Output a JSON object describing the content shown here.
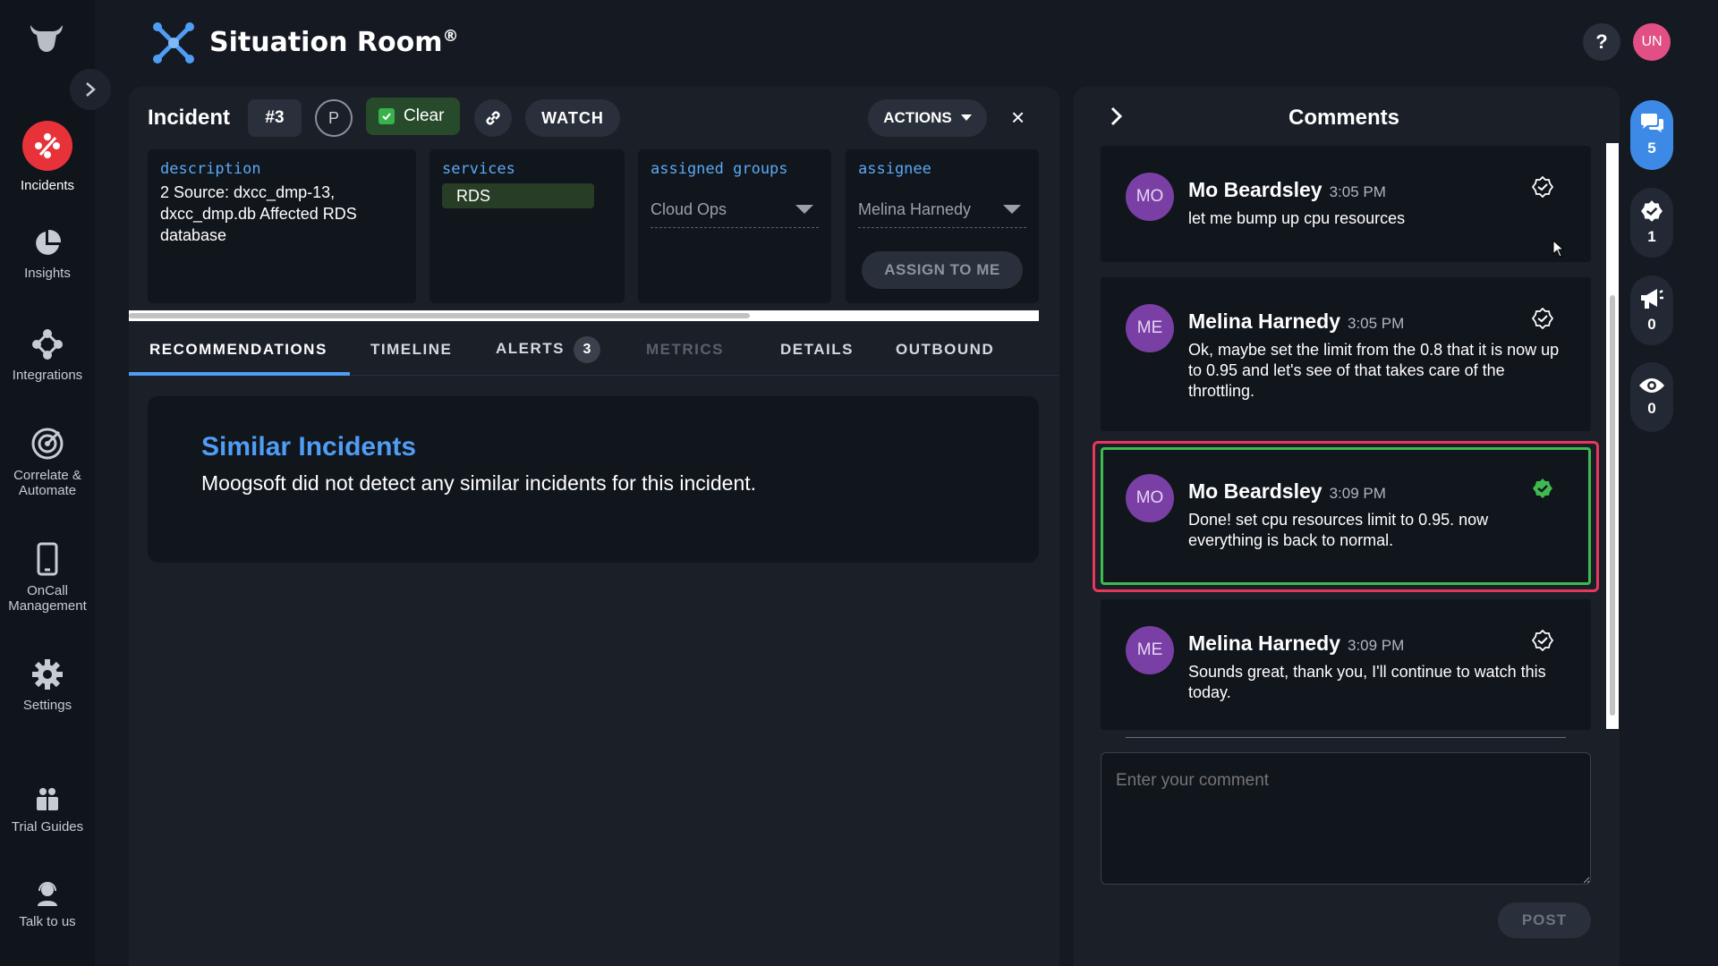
{
  "app": {
    "title": "Situation Room",
    "title_mark": "®",
    "user_initials": "UN",
    "help_label": "?"
  },
  "colors": {
    "accent_blue": "#4f9df5",
    "incidents_red": "#e8323a",
    "status_clear_green": "#37b24d",
    "highlight_red": "#e8365d",
    "highlight_green": "#3fb950",
    "avatar_purple": "#7a3fa5"
  },
  "nav": {
    "items": [
      {
        "label": "Incidents",
        "icon": "incidents-icon",
        "active": true
      },
      {
        "label": "Insights",
        "icon": "pie-chart-icon"
      },
      {
        "label": "Integrations",
        "icon": "integrations-icon"
      },
      {
        "label": "Correlate & Automate",
        "icon": "target-icon"
      },
      {
        "label": "OnCall Management",
        "icon": "phone-icon"
      },
      {
        "label": "Settings",
        "icon": "gear-icon"
      },
      {
        "label": "Trial Guides",
        "icon": "guide-icon"
      },
      {
        "label": "Talk to us",
        "icon": "support-icon"
      }
    ]
  },
  "incident": {
    "title": "Incident",
    "number": "#3",
    "priority": "P",
    "status": "Clear",
    "watch_label": "WATCH",
    "actions_label": "ACTIONS",
    "close_label": "×",
    "description_label": "description",
    "description": "2 Source: dxcc_dmp-13, dxcc_dmp.db Affected RDS database",
    "services_label": "services",
    "service": "RDS",
    "groups_label": "assigned groups",
    "group": "Cloud Ops",
    "assignee_label": "assignee",
    "assignee": "Melina Harnedy",
    "assign_to_me": "ASSIGN TO ME"
  },
  "tabs": {
    "recommendations": "RECOMMENDATIONS",
    "timeline": "TIMELINE",
    "alerts": "ALERTS",
    "alerts_count": "3",
    "metrics": "METRICS",
    "details": "DETAILS",
    "outbound": "OUTBOUND"
  },
  "similar": {
    "title": "Similar Incidents",
    "text": "Moogsoft did not detect any similar incidents for this incident."
  },
  "comments": {
    "title": "Comments",
    "items": [
      {
        "initials": "MO",
        "author": "Mo Beardsley",
        "time": "3:05 PM",
        "text": "let me bump up cpu resources",
        "resolved": false
      },
      {
        "initials": "ME",
        "author": "Melina Harnedy",
        "time": "3:05 PM",
        "text": "Ok, maybe set the limit from the 0.8 that it is now up to 0.95 and let's see of that takes care of the throttling.",
        "resolved": false
      },
      {
        "initials": "MO",
        "author": "Mo Beardsley",
        "time": "3:09 PM",
        "text": "Done! set cpu resources limit to 0.95. now everything is back to normal.",
        "resolved": true
      },
      {
        "initials": "ME",
        "author": "Melina Harnedy",
        "time": "3:09 PM",
        "text": "Sounds great, thank you, I'll continue to watch this today.",
        "resolved": false
      }
    ],
    "input_placeholder": "Enter your comment",
    "post_label": "POST"
  },
  "rail": {
    "comments_count": "5",
    "resolutions_count": "1",
    "announcements_count": "0",
    "watchers_count": "0"
  }
}
